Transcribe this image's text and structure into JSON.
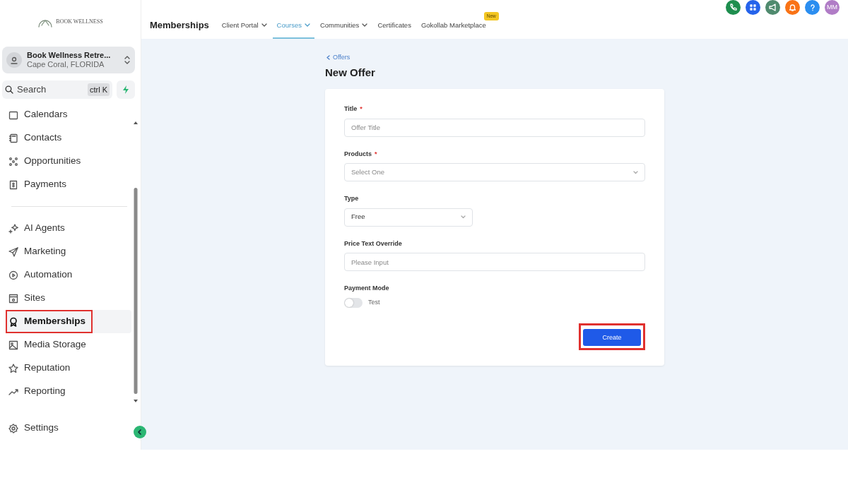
{
  "logo": {
    "text": "BOOK WELLNESS"
  },
  "account": {
    "name": "Book Wellness Retre...",
    "location": "Cape Coral, FLORIDA"
  },
  "search": {
    "label": "Search",
    "shortcut": "ctrl K"
  },
  "nav_groups": [
    [
      {
        "label": "Calendars",
        "selected": false,
        "highlighted": false
      },
      {
        "label": "Contacts",
        "selected": false,
        "highlighted": false
      },
      {
        "label": "Opportunities",
        "selected": false,
        "highlighted": false
      },
      {
        "label": "Payments",
        "selected": false,
        "highlighted": false
      }
    ],
    [
      {
        "label": "AI Agents",
        "selected": false,
        "highlighted": false
      },
      {
        "label": "Marketing",
        "selected": false,
        "highlighted": false
      },
      {
        "label": "Automation",
        "selected": false,
        "highlighted": false
      },
      {
        "label": "Sites",
        "selected": false,
        "highlighted": false
      },
      {
        "label": "Memberships",
        "selected": true,
        "highlighted": true
      },
      {
        "label": "Media Storage",
        "selected": false,
        "highlighted": false
      },
      {
        "label": "Reputation",
        "selected": false,
        "highlighted": false
      },
      {
        "label": "Reporting",
        "selected": false,
        "highlighted": false
      }
    ]
  ],
  "settings": {
    "label": "Settings"
  },
  "header": {
    "title": "Memberships",
    "tabs": [
      {
        "label": "Client Portal",
        "dropdown": true,
        "selected": false
      },
      {
        "label": "Courses",
        "dropdown": true,
        "selected": true
      },
      {
        "label": "Communities",
        "dropdown": true,
        "selected": false
      },
      {
        "label": "Certificates",
        "dropdown": false,
        "selected": false
      },
      {
        "label": "Gokollab Marketplace",
        "dropdown": false,
        "selected": false,
        "badge": "New"
      }
    ]
  },
  "header_actions": [
    {
      "kind": "phone",
      "color": "#1e8e4e"
    },
    {
      "kind": "apps",
      "color": "#2563eb"
    },
    {
      "kind": "megaphone",
      "color": "#4f8a6e"
    },
    {
      "kind": "bell",
      "color": "#f97316"
    },
    {
      "kind": "help",
      "color": "#2b8ef0"
    },
    {
      "kind": "avatar",
      "color": "#b07cc6",
      "text": "MM"
    }
  ],
  "breadcrumb": "Offers",
  "page_title": "New Offer",
  "form": {
    "fields": [
      {
        "kind": "text",
        "label": "Title",
        "required_mark": "*",
        "placeholder": "Offer Title"
      },
      {
        "kind": "select",
        "label": "Products",
        "required_mark": "*",
        "placeholder": "Select One"
      },
      {
        "kind": "select_short",
        "label": "Type",
        "value": "Free"
      },
      {
        "kind": "text",
        "label": "Price Text Override",
        "placeholder": "Please Input"
      },
      {
        "kind": "toggle",
        "label": "Payment Mode",
        "on": false,
        "text": "Test"
      }
    ],
    "submit": {
      "label": "Create",
      "highlighted": true
    }
  }
}
